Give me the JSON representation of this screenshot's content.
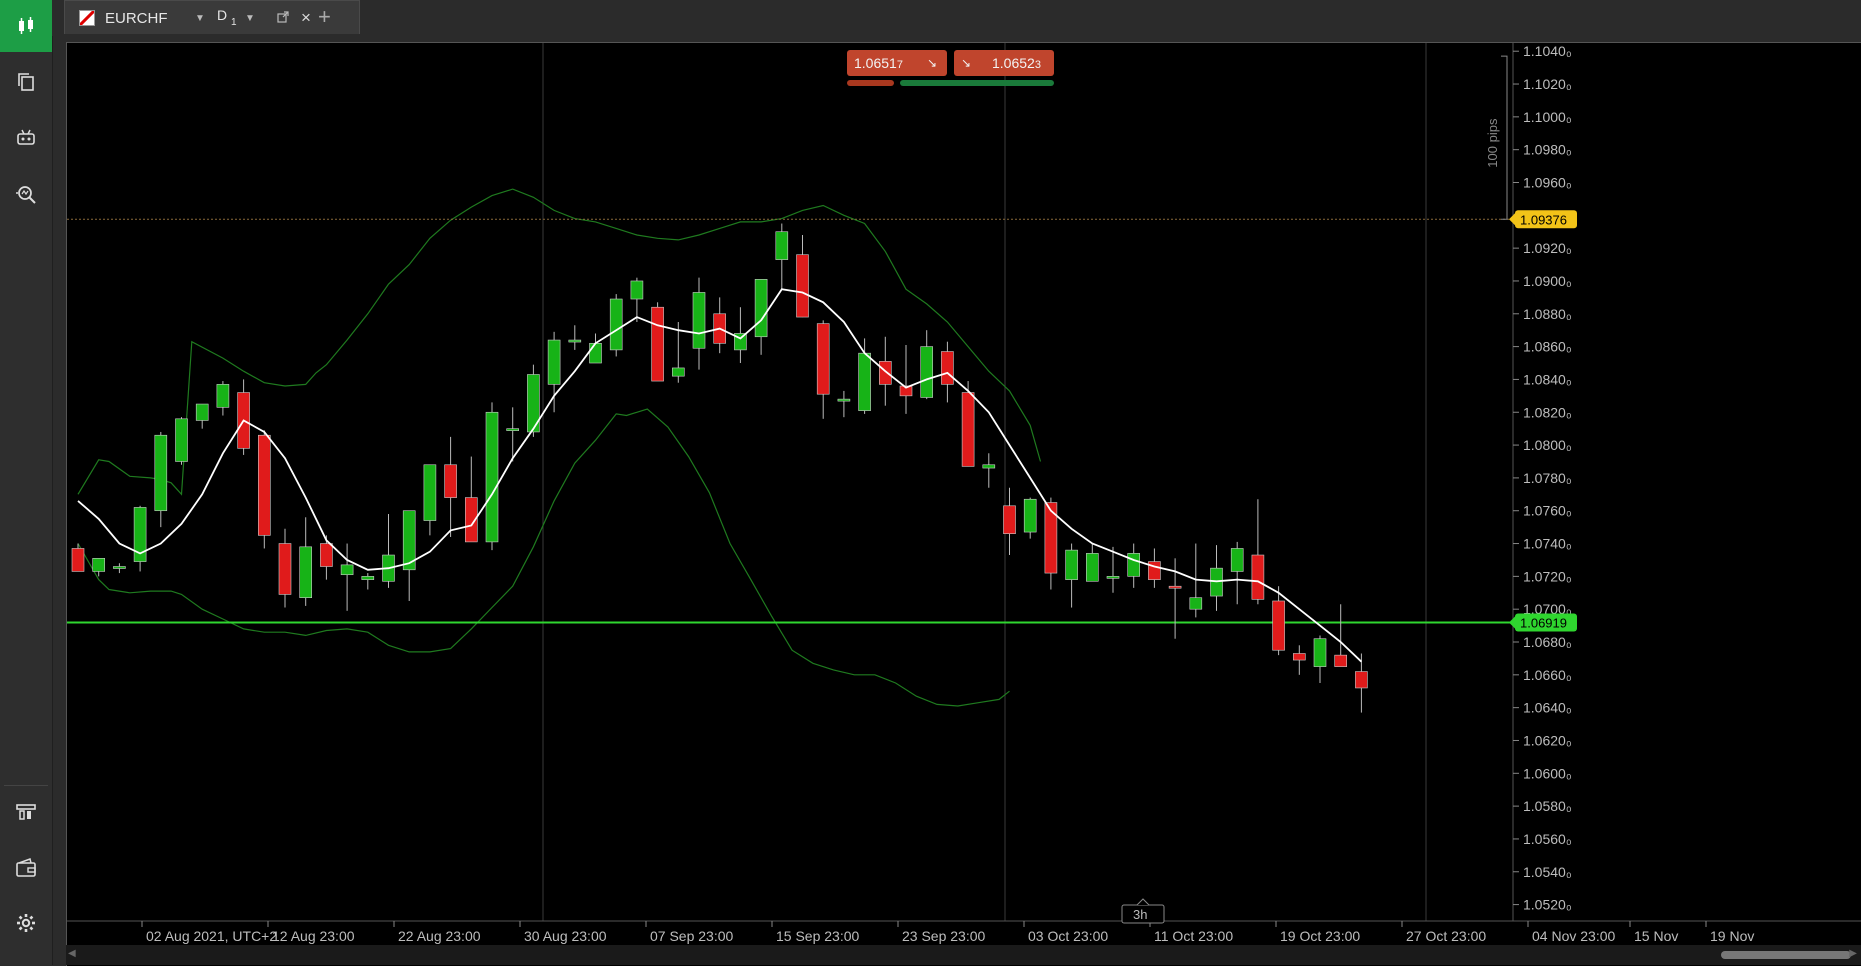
{
  "sidebar": {
    "items": [
      {
        "name": "chart-mode-icon",
        "active": true
      },
      {
        "name": "copy-icon"
      },
      {
        "name": "bot-icon"
      },
      {
        "name": "scan-search-icon"
      },
      {
        "name": "trade-icon"
      },
      {
        "name": "wallet-icon"
      },
      {
        "name": "gear-icon"
      }
    ]
  },
  "tab": {
    "symbol": "EURCHF",
    "timeframe": "D",
    "timeframe_sub": "1",
    "close": "×",
    "add": "+"
  },
  "price_buttons": {
    "sell_main": "1.0651",
    "sell_sub": "7",
    "buy_main": "1.0652",
    "buy_sub": "3"
  },
  "chart_data": {
    "type": "candlestick",
    "symbol": "EURCHF",
    "timeframe": "D1",
    "y_ticks": [
      "1.1040₀",
      "1.1020₀",
      "1.1000₀",
      "1.0980₀",
      "1.0960₀",
      "1.0940₀",
      "1.0920₀",
      "1.0900₀",
      "1.0880₀",
      "1.0860₀",
      "1.0840₀",
      "1.0820₀",
      "1.0800₀",
      "1.0780₀",
      "1.0760₀",
      "1.0740₀",
      "1.0720₀",
      "1.0700₀",
      "1.0680₀",
      "1.0660₀",
      "1.0640₀",
      "1.0620₀",
      "1.0600₀",
      "1.0580₀",
      "1.0560₀",
      "1.0540₀",
      "1.0520₀"
    ],
    "y_tick_values": [
      1.104,
      1.102,
      1.1,
      1.098,
      1.096,
      1.094,
      1.092,
      1.09,
      1.088,
      1.086,
      1.084,
      1.082,
      1.08,
      1.078,
      1.076,
      1.074,
      1.072,
      1.07,
      1.068,
      1.066,
      1.064,
      1.062,
      1.06,
      1.058,
      1.056,
      1.054,
      1.052
    ],
    "x_ticks": [
      "02 Aug 2021, UTC+2",
      "12 Aug 23:00",
      "22 Aug 23:00",
      "30 Aug 23:00",
      "07 Sep 23:00",
      "15 Sep 23:00",
      "23 Sep 23:00",
      "03 Oct 23:00",
      "11 Oct 23:00",
      "19 Oct 23:00",
      "27 Oct 23:00",
      "04 Nov 23:00",
      "15 Nov",
      "19 Nov"
    ],
    "ylim": [
      1.051,
      1.1045
    ],
    "horizontal_lines": [
      {
        "price": 1.09376,
        "label": "1.09376",
        "color": "#8a6a3a",
        "label_bg": "#f2c318",
        "label_fg": "#000000",
        "style": "dotted"
      },
      {
        "price": 1.06919,
        "label": "1.06919",
        "color": "#2fd62f",
        "label_bg": "#2fd62f",
        "label_fg": "#000000",
        "style": "solid"
      }
    ],
    "pips_label": "100 pips",
    "zoom_label": "3h",
    "colors": {
      "up": "#17b317",
      "down": "#e01b1b",
      "ma": "#ffffff",
      "band": "#1f7a1f",
      "bg": "#000000",
      "grid": "#3a3a3a"
    },
    "candles": [
      [
        1.0737,
        1.074,
        1.0725,
        1.0723
      ],
      [
        1.0723,
        1.073,
        1.072,
        1.0731
      ],
      [
        1.0725,
        1.0728,
        1.0722,
        1.0726
      ],
      [
        1.0729,
        1.0763,
        1.0723,
        1.0762
      ],
      [
        1.076,
        1.0808,
        1.075,
        1.0806
      ],
      [
        1.079,
        1.0817,
        1.0788,
        1.0816
      ],
      [
        1.0815,
        1.0825,
        1.081,
        1.0825
      ],
      [
        1.0823,
        1.0839,
        1.0818,
        1.0837
      ],
      [
        1.0832,
        1.084,
        1.0794,
        1.0798
      ],
      [
        1.0806,
        1.0809,
        1.0737,
        1.0745
      ],
      [
        1.074,
        1.0749,
        1.0701,
        1.0709
      ],
      [
        1.0707,
        1.0756,
        1.0702,
        1.0738
      ],
      [
        1.074,
        1.0745,
        1.0718,
        1.0726
      ],
      [
        1.0721,
        1.074,
        1.0699,
        1.0727
      ],
      [
        1.0718,
        1.0722,
        1.0712,
        1.072
      ],
      [
        1.0717,
        1.0758,
        1.0713,
        1.0733
      ],
      [
        1.0724,
        1.0739,
        1.0705,
        1.076
      ],
      [
        1.0754,
        1.0785,
        1.0745,
        1.0788
      ],
      [
        1.0788,
        1.0805,
        1.0744,
        1.0768
      ],
      [
        1.0768,
        1.0793,
        1.0755,
        1.0741
      ],
      [
        1.0741,
        1.0826,
        1.0736,
        1.082
      ],
      [
        1.0809,
        1.0823,
        1.079,
        1.081
      ],
      [
        1.0808,
        1.0849,
        1.0805,
        1.0843
      ],
      [
        1.0837,
        1.0869,
        1.082,
        1.0864
      ],
      [
        1.0863,
        1.0873,
        1.0858,
        1.0864
      ],
      [
        1.085,
        1.0868,
        1.085,
        1.0862
      ],
      [
        1.0858,
        1.0892,
        1.0854,
        1.0889
      ],
      [
        1.0889,
        1.0902,
        1.0875,
        1.09
      ],
      [
        1.0884,
        1.0887,
        1.084,
        1.0839
      ],
      [
        1.0842,
        1.0875,
        1.0838,
        1.0847
      ],
      [
        1.0859,
        1.0902,
        1.0846,
        1.0893
      ],
      [
        1.088,
        1.089,
        1.0856,
        1.0862
      ],
      [
        1.0858,
        1.0884,
        1.085,
        1.0868
      ],
      [
        1.0866,
        1.0899,
        1.0855,
        1.0901
      ],
      [
        1.0913,
        1.0935,
        1.0895,
        1.093
      ],
      [
        1.0916,
        1.0928,
        1.0878,
        1.0878
      ],
      [
        1.0874,
        1.0876,
        1.0816,
        1.0831
      ],
      [
        1.0828,
        1.0833,
        1.0817,
        1.0828
      ],
      [
        1.0821,
        1.0865,
        1.0819,
        1.0856
      ],
      [
        1.0851,
        1.0866,
        1.0824,
        1.0837
      ],
      [
        1.0836,
        1.0861,
        1.0819,
        1.083
      ],
      [
        1.0829,
        1.087,
        1.0828,
        1.086
      ],
      [
        1.0857,
        1.0863,
        1.0826,
        1.0837
      ],
      [
        1.0832,
        1.0839,
        1.0787,
        1.0787
      ],
      [
        1.0786,
        1.0795,
        1.0774,
        1.0788
      ],
      [
        1.0763,
        1.0774,
        1.0733,
        1.0746
      ],
      [
        1.0747,
        1.0768,
        1.0743,
        1.0767
      ],
      [
        1.0765,
        1.0768,
        1.0712,
        1.0722
      ],
      [
        1.0718,
        1.074,
        1.0701,
        1.0736
      ],
      [
        1.0717,
        1.074,
        1.0718,
        1.0734
      ],
      [
        1.0719,
        1.0738,
        1.071,
        1.072
      ],
      [
        1.072,
        1.074,
        1.0713,
        1.0734
      ],
      [
        1.0729,
        1.0737,
        1.0713,
        1.0718
      ],
      [
        1.0714,
        1.0731,
        1.0682,
        1.0713
      ],
      [
        1.07,
        1.074,
        1.0695,
        1.0707
      ],
      [
        1.0708,
        1.0739,
        1.0699,
        1.0725
      ],
      [
        1.0723,
        1.0741,
        1.0703,
        1.0737
      ],
      [
        1.0733,
        1.0767,
        1.0703,
        1.0706
      ],
      [
        1.0705,
        1.0714,
        1.0672,
        1.0675
      ],
      [
        1.0673,
        1.0678,
        1.066,
        1.0669
      ],
      [
        1.0665,
        1.0684,
        1.0655,
        1.0682
      ],
      [
        1.0672,
        1.0703,
        1.0667,
        1.0665
      ],
      [
        1.0662,
        1.0673,
        1.0637,
        1.0652
      ]
    ],
    "ma": [
      1.0766,
      1.0755,
      1.074,
      1.0734,
      1.074,
      1.0752,
      1.077,
      1.0795,
      1.0815,
      1.0808,
      1.0792,
      1.0768,
      1.0742,
      1.073,
      1.0724,
      1.0725,
      1.0728,
      1.0735,
      1.0748,
      1.0751,
      1.077,
      1.0792,
      1.081,
      1.083,
      1.0845,
      1.0862,
      1.087,
      1.0878,
      1.0873,
      1.087,
      1.0868,
      1.0871,
      1.0865,
      1.0876,
      1.0895,
      1.0893,
      1.0887,
      1.0875,
      1.0856,
      1.0845,
      1.0835,
      1.084,
      1.0844,
      1.0833,
      1.082,
      1.08,
      1.078,
      1.076,
      1.0749,
      1.074,
      1.0735,
      1.073,
      1.0726,
      1.0723,
      1.0718,
      1.0717,
      1.0718,
      1.0717,
      1.071,
      1.07,
      1.069,
      1.068,
      1.0668
    ],
    "upper_band": [
      [
        0,
        1.077
      ],
      [
        2,
        1.0791
      ],
      [
        3,
        1.079
      ],
      [
        5,
        1.0781
      ],
      [
        7,
        1.078
      ],
      [
        8,
        1.0779
      ],
      [
        9,
        1.0777
      ],
      [
        10,
        1.077
      ],
      [
        11,
        1.0863
      ],
      [
        14,
        1.0853
      ],
      [
        16,
        1.0845
      ],
      [
        18,
        1.0838
      ],
      [
        20,
        1.0836
      ],
      [
        22,
        1.0837
      ],
      [
        23,
        1.0844
      ],
      [
        24,
        1.0849
      ],
      [
        26,
        1.0864
      ],
      [
        28,
        1.088
      ],
      [
        30,
        1.0898
      ],
      [
        32,
        1.091
      ],
      [
        34,
        1.0926
      ],
      [
        36,
        1.0937
      ],
      [
        38,
        1.0945
      ],
      [
        40,
        1.0952
      ],
      [
        42,
        1.0956
      ],
      [
        44,
        1.0951
      ],
      [
        46,
        1.0943
      ],
      [
        48,
        1.0938
      ],
      [
        50,
        1.0936
      ],
      [
        52,
        1.0932
      ],
      [
        54,
        1.0928
      ],
      [
        56,
        1.0926
      ],
      [
        58,
        1.0925
      ],
      [
        60,
        1.0928
      ],
      [
        62,
        1.0932
      ],
      [
        64,
        1.0936
      ],
      [
        66,
        1.0936
      ],
      [
        68,
        1.0938
      ],
      [
        70,
        1.0943
      ],
      [
        72,
        1.0946
      ],
      [
        74,
        1.094
      ],
      [
        76,
        1.0935
      ],
      [
        78,
        1.0918
      ],
      [
        80,
        1.0895
      ],
      [
        82,
        1.0886
      ],
      [
        84,
        1.0875
      ],
      [
        86,
        1.086
      ],
      [
        88,
        1.0845
      ],
      [
        90,
        1.0833
      ],
      [
        92,
        1.0812
      ],
      [
        93,
        1.079
      ]
    ],
    "lower_band": [
      [
        0,
        1.074
      ],
      [
        2,
        1.0718
      ],
      [
        3,
        1.0712
      ],
      [
        5,
        1.071
      ],
      [
        7,
        1.0711
      ],
      [
        9,
        1.0711
      ],
      [
        10,
        1.0709
      ],
      [
        12,
        1.07
      ],
      [
        14,
        1.0694
      ],
      [
        16,
        1.0688
      ],
      [
        18,
        1.0686
      ],
      [
        20,
        1.0686
      ],
      [
        22,
        1.0684
      ],
      [
        24,
        1.0687
      ],
      [
        26,
        1.0688
      ],
      [
        28,
        1.0686
      ],
      [
        30,
        1.0678
      ],
      [
        32,
        1.0674
      ],
      [
        34,
        1.0674
      ],
      [
        36,
        1.0676
      ],
      [
        38,
        1.0688
      ],
      [
        40,
        1.0701
      ],
      [
        42,
        1.0714
      ],
      [
        44,
        1.0738
      ],
      [
        46,
        1.0766
      ],
      [
        48,
        1.0789
      ],
      [
        50,
        1.0803
      ],
      [
        52,
        1.0819
      ],
      [
        53,
        1.0818
      ],
      [
        55,
        1.0822
      ],
      [
        57,
        1.0811
      ],
      [
        59,
        1.0793
      ],
      [
        61,
        1.0771
      ],
      [
        63,
        1.074
      ],
      [
        65,
        1.0718
      ],
      [
        67,
        1.0696
      ],
      [
        69,
        1.0675
      ],
      [
        71,
        1.0667
      ],
      [
        73,
        1.0663
      ],
      [
        75,
        1.066
      ],
      [
        77,
        1.066
      ],
      [
        79,
        1.0655
      ],
      [
        81,
        1.0647
      ],
      [
        83,
        1.0642
      ],
      [
        85,
        1.0641
      ],
      [
        87,
        1.0643
      ],
      [
        89,
        1.0645
      ],
      [
        90,
        1.065
      ]
    ]
  }
}
